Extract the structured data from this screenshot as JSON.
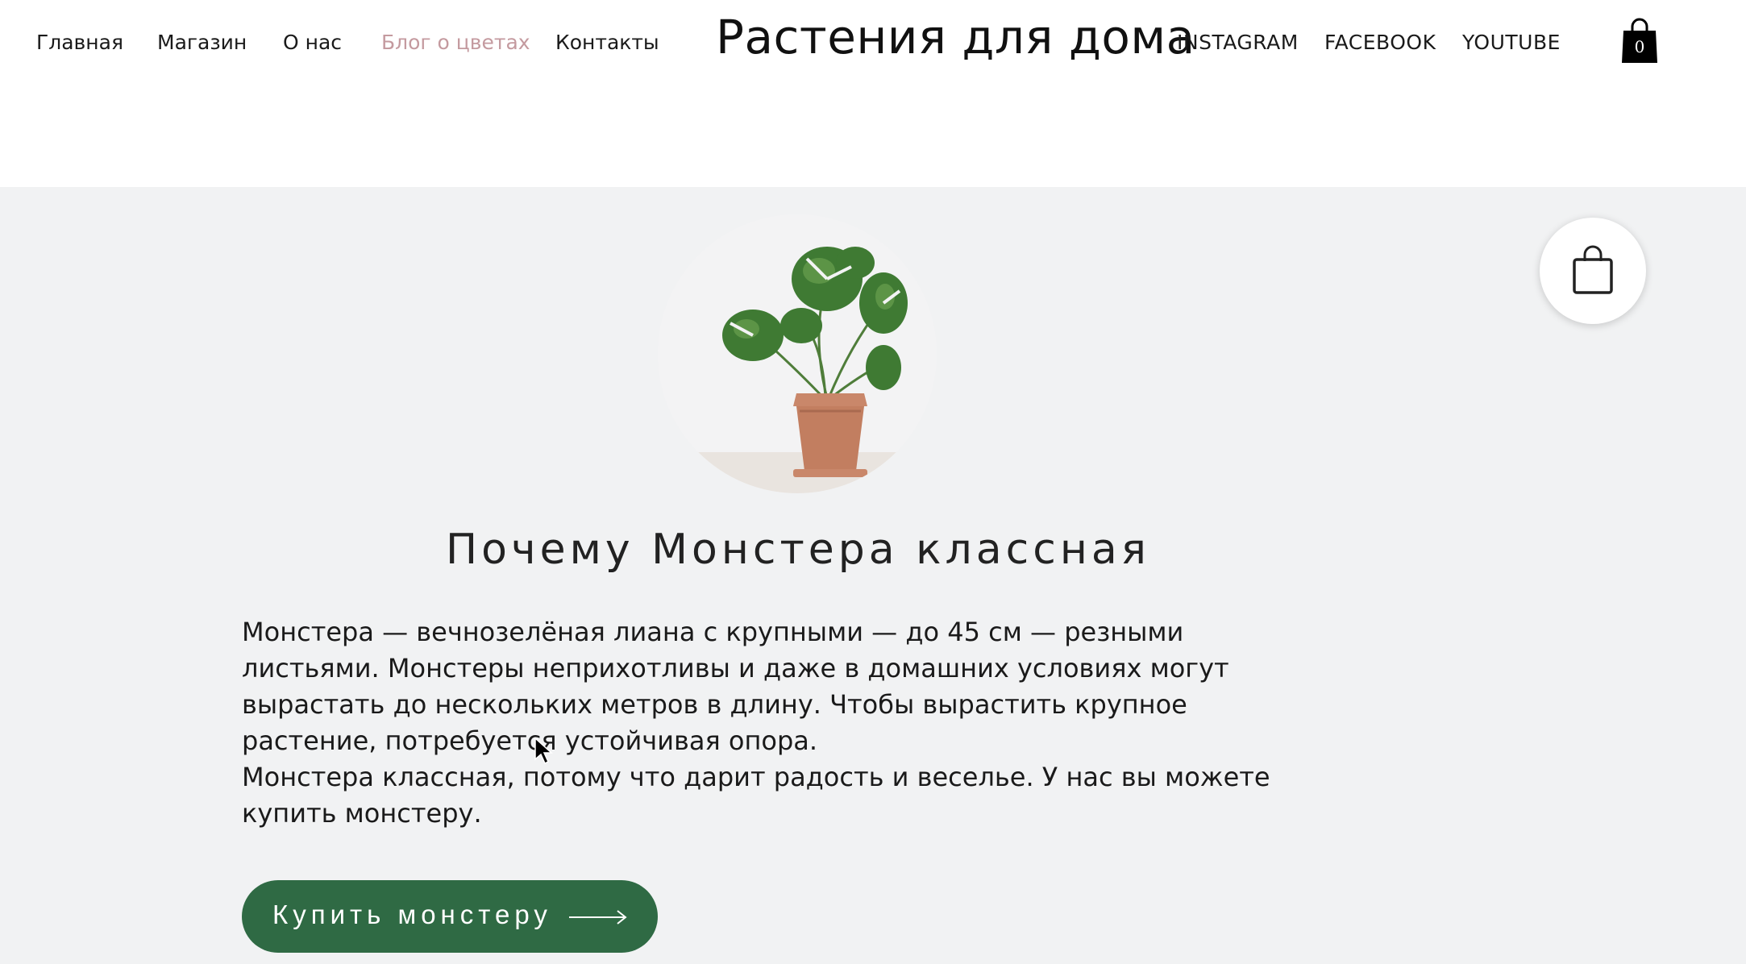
{
  "nav": {
    "home": "Главная",
    "shop": "Магазин",
    "about": "О нас",
    "blog": "Блог о цветах",
    "contacts": "Контакты"
  },
  "site_title": "Растения для дома",
  "social": {
    "instagram": "INSTAGRAM",
    "facebook": "FACEBOOK",
    "youtube": "YOUTUBE"
  },
  "cart": {
    "count": "0",
    "icon": "shopping-bag-icon",
    "floating_icon": "shopping-bag-outline-icon"
  },
  "article": {
    "heading": "Почему Монстера классная",
    "paragraph1": "Монстера — вечнозелёная лиана с крупными — до 45 см — резными листьями. Монстеры неприхотливы и даже в домашних условиях могут вырастать до нескольких метров в длину. Чтобы вырастить крупное растение, потребуется устойчивая опора.",
    "paragraph2": "Монстера классная, потому что дарит радость и веселье. У нас вы можете купить монстеру.",
    "image": "monstera-plant-image"
  },
  "cta": {
    "label": "Купить монстеру",
    "icon": "arrow-right-icon"
  },
  "colors": {
    "nav_active": "#c49a9f",
    "cta_background": "#2f6a44",
    "content_background": "#f1f2f3",
    "header_background": "#ffffff"
  }
}
